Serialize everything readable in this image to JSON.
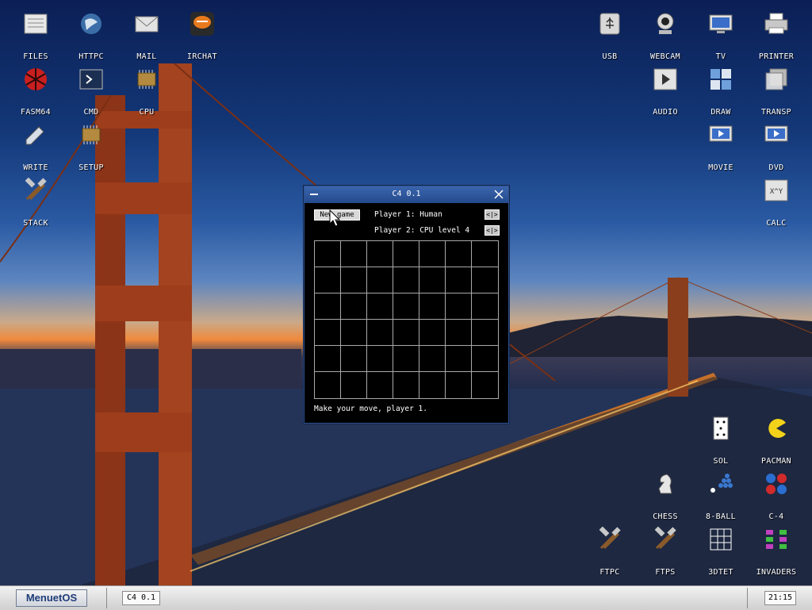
{
  "desktop": {
    "icons": [
      {
        "label": "FILES",
        "icon": "files-icon"
      },
      {
        "label": "HTTPC",
        "icon": "httpc-icon"
      },
      {
        "label": "MAIL",
        "icon": "mail-icon"
      },
      {
        "label": "IRCHAT",
        "icon": "irchat-icon"
      },
      {
        "label": "FASM64",
        "icon": "fasm64-icon"
      },
      {
        "label": "CMD",
        "icon": "cmd-icon"
      },
      {
        "label": "CPU",
        "icon": "cpu-icon"
      },
      {
        "label": "WRITE",
        "icon": "write-icon"
      },
      {
        "label": "SETUP",
        "icon": "setup-icon"
      },
      {
        "label": "STACK",
        "icon": "stack-icon"
      },
      {
        "label": "USB",
        "icon": "usb-icon"
      },
      {
        "label": "WEBCAM",
        "icon": "webcam-icon"
      },
      {
        "label": "TV",
        "icon": "tv-icon"
      },
      {
        "label": "PRINTER",
        "icon": "printer-icon"
      },
      {
        "label": "AUDIO",
        "icon": "audio-icon"
      },
      {
        "label": "DRAW",
        "icon": "draw-icon"
      },
      {
        "label": "TRANSP",
        "icon": "transp-icon"
      },
      {
        "label": "MOVIE",
        "icon": "movie-icon"
      },
      {
        "label": "DVD",
        "icon": "dvd-icon"
      },
      {
        "label": "CALC",
        "icon": "calc-icon",
        "glyph_text": "X^Y"
      },
      {
        "label": "SOL",
        "icon": "sol-icon"
      },
      {
        "label": "PACMAN",
        "icon": "pacman-icon"
      },
      {
        "label": "CHESS",
        "icon": "chess-icon"
      },
      {
        "label": "8-BALL",
        "icon": "8ball-icon"
      },
      {
        "label": "C-4",
        "icon": "c4-icon"
      },
      {
        "label": "FTPC",
        "icon": "ftpc-icon"
      },
      {
        "label": "FTPS",
        "icon": "ftps-icon"
      },
      {
        "label": "3DTET",
        "icon": "3dtet-icon"
      },
      {
        "label": "INVADERS",
        "icon": "invaders-icon"
      }
    ]
  },
  "window": {
    "title": "C4 0.1",
    "new_game_label": "New game",
    "player1": "Player 1: Human",
    "player2": "Player 2: CPU level 4",
    "arrows": "<|>",
    "status": "Make your move, player 1.",
    "board": {
      "rows": 6,
      "cols": 7
    }
  },
  "taskbar": {
    "start_label": "MenuetOS",
    "task_label": "C4 0.1",
    "clock": "21:15"
  },
  "colors": {
    "accent": "#2e5190",
    "taskbar": "#dcdcdc"
  }
}
